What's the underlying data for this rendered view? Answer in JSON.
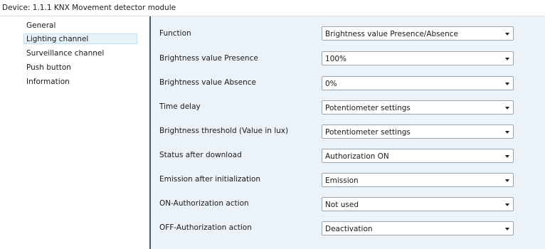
{
  "device_title": "Device: 1.1.1  KNX Movement detector module",
  "sidebar": {
    "items": [
      {
        "label": "General"
      },
      {
        "label": "Lighting channel"
      },
      {
        "label": "Surveillance channel"
      },
      {
        "label": "Push button"
      },
      {
        "label": "Information"
      }
    ],
    "selected": "Lighting channel"
  },
  "params": [
    {
      "label": "Function",
      "value": "Brightness value Presence/Absence"
    },
    {
      "label": "Brightness value Presence",
      "value": "100%"
    },
    {
      "label": "Brightness value Absence",
      "value": "0%"
    },
    {
      "label": "Time delay",
      "value": "Potentiometer settings"
    },
    {
      "label": "Brightness threshold (Value in lux)",
      "value": "Potentiometer settings"
    },
    {
      "label": "Status after download",
      "value": "Authorization ON"
    },
    {
      "label": "Emission after initialization",
      "value": "Emission"
    },
    {
      "label": "ON-Authorization action",
      "value": "Not used"
    },
    {
      "label": "OFF-Authorization action",
      "value": "Deactivation"
    }
  ]
}
